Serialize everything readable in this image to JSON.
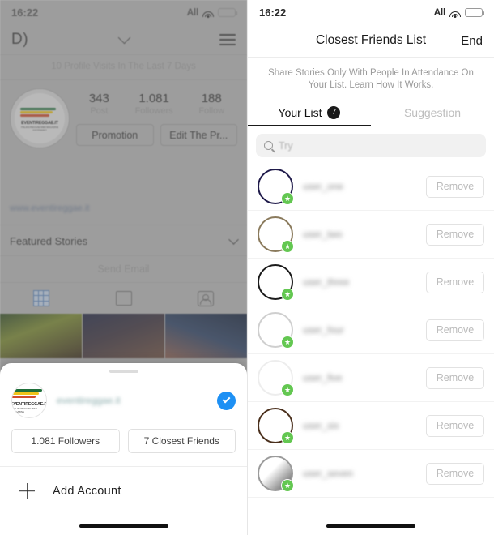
{
  "left": {
    "statusbar": {
      "time": "16:22",
      "carrier": "All"
    },
    "nav": {
      "username": "D)",
      "chevron_icon": "chevron-down-icon",
      "menu_icon": "hamburger-icon"
    },
    "visits_banner": "10 Profile Visits In The Last 7 Days",
    "profile": {
      "logo_name": "EVENTIREGGAE.IT",
      "logo_sub": "ITALIAN REGGAE WEB MAGAZINE",
      "logo_sub2": "eventireggae.it",
      "stats": [
        {
          "num": "343",
          "label": "Post"
        },
        {
          "num": "1.081",
          "label": "Followers"
        },
        {
          "num": "188",
          "label": "Follow"
        }
      ],
      "buttons": [
        {
          "label": "Promotion"
        },
        {
          "label": "Edit The Pr..."
        }
      ],
      "website": "www.eventireggae.it",
      "featured_stories": "Featured Stories",
      "send_email": "Send Email"
    },
    "tabs": [
      {
        "icon": "grid-icon",
        "name": "grid"
      },
      {
        "icon": "tv-icon",
        "name": "igtv"
      },
      {
        "icon": "tagged-icon",
        "name": "tagged"
      }
    ],
    "sheet": {
      "account_name": "eventireggae.it",
      "selected_icon": "check-circle-icon",
      "buttons": [
        {
          "label": "1.081 Followers"
        },
        {
          "label": "7 Closest Friends"
        }
      ],
      "add_account": "Add Account",
      "add_icon": "plus-icon"
    }
  },
  "right": {
    "statusbar": {
      "time": "16:22",
      "carrier": "All"
    },
    "nav": {
      "title": "Closest Friends List",
      "end_label": "End"
    },
    "description": "Share Stories Only With People In Attendance On Your List. Learn How It Works.",
    "tabs": [
      {
        "label": "Your List",
        "badge": "7",
        "active": true
      },
      {
        "label": "Suggestion",
        "badge": "",
        "active": false
      }
    ],
    "search": {
      "placeholder": "Try",
      "icon": "search-icon"
    },
    "friends": [
      {
        "name": "user_one",
        "ring": "#1f1a4a",
        "badge_icon": "star-badge-icon",
        "remove_label": "Remove"
      },
      {
        "name": "user_two",
        "ring": "#8a7a5c",
        "badge_icon": "star-badge-icon",
        "remove_label": "Remove"
      },
      {
        "name": "user_three",
        "ring": "#1b1b1b",
        "badge_icon": "star-badge-icon",
        "remove_label": "Remove"
      },
      {
        "name": "user_four",
        "ring": "#cfcfcf",
        "badge_icon": "star-badge-icon",
        "remove_label": "Remove"
      },
      {
        "name": "user_five",
        "ring": "#efefef",
        "badge_icon": "star-badge-icon",
        "remove_label": "Remove"
      },
      {
        "name": "user_six",
        "ring": "#4a2f1c",
        "badge_icon": "star-badge-icon",
        "remove_label": "Remove"
      },
      {
        "name": "user_seven",
        "ring": "#9b9b9b",
        "badge_icon": "star-badge-icon",
        "remove_label": "Remove"
      }
    ]
  },
  "colors": {
    "accent_blue": "#1d90f4",
    "badge_green": "#63c751",
    "battery_red": "#ef5b5b",
    "dim_overlay": "#b9b9b9"
  }
}
